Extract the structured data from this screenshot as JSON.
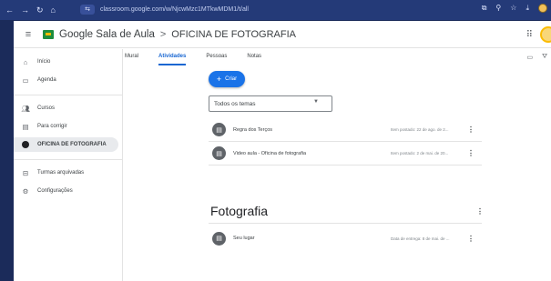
{
  "browser": {
    "url": "classroom.google.com/w/NjcwMzc1MTkwMDM1/t/all"
  },
  "header": {
    "app_name": "Google Sala de Aula",
    "separator": ">",
    "class_name": "OFICINA DE FOTOGRAFIA"
  },
  "sidebar": {
    "items": [
      {
        "label": "Início",
        "icon": "home-icon"
      },
      {
        "label": "Agenda",
        "icon": "calendar-icon"
      },
      {
        "label": "Cursos",
        "icon": "people-icon"
      },
      {
        "label": "Para corrigir",
        "icon": "todo-icon"
      },
      {
        "label": "OFICINA DE FOTOGRAFIA",
        "icon": "class-dot-icon"
      },
      {
        "label": "Turmas arquivadas",
        "icon": "archive-icon"
      },
      {
        "label": "Configurações",
        "icon": "settings-icon"
      }
    ]
  },
  "tabs": [
    {
      "label": "Mural"
    },
    {
      "label": "Atividades"
    },
    {
      "label": "Pessoas"
    },
    {
      "label": "Notas"
    }
  ],
  "toolbar": {
    "create_label": "Criar"
  },
  "topic_filter": {
    "value": "Todos os temas"
  },
  "items": [
    {
      "title": "Regra dos Terços",
      "meta": "Item postado: 22 de ago. de 2..."
    },
    {
      "title": "Video aula - Oficina de fotografia",
      "meta": "Item postado: 2 de mai. de 20..."
    }
  ],
  "section": {
    "title": "Fotografia",
    "items": [
      {
        "title": "Seu lugar",
        "meta": "Data de entrega: 8 de mai. de ..."
      }
    ]
  },
  "colors": {
    "accent": "#1a73e8",
    "background": "#1b2b5a"
  }
}
